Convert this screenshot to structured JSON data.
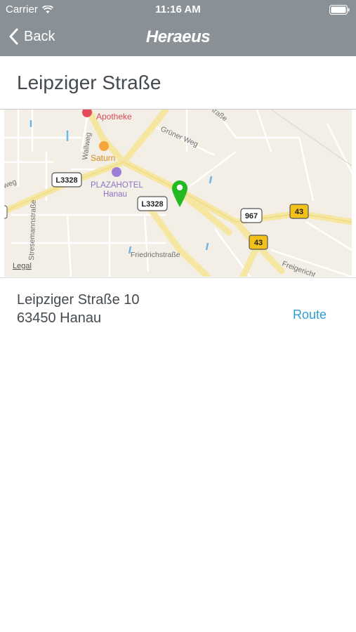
{
  "status_bar": {
    "carrier": "Carrier",
    "time": "11:16 AM"
  },
  "nav_bar": {
    "back_label": "Back",
    "logo_text": "Heraeus"
  },
  "page_title": "Leipziger Straße",
  "map": {
    "pois": {
      "pharmacy": "Apotheke",
      "saturn": "Saturn",
      "hotel_line1": "PLAZAHOTEL",
      "hotel_line2": "Hanau"
    },
    "streets": {
      "gruener_weg": "Grüner Weg",
      "wallweg": "Wallweg",
      "stresemannstrasse": "Stresemannstraße",
      "friedrichstrasse": "Friedrichstraße",
      "weg": "weg",
      "strasse_top": "traße",
      "freigericht": "Freigericht"
    },
    "road_badges": {
      "l3328_a": "L3328",
      "l3328_b": "L3328",
      "r967": "967",
      "r43_a": "43",
      "r43_b": "43"
    },
    "legal": "Legal",
    "pin_color": "#22b922"
  },
  "address": {
    "street": "Leipziger Straße 10",
    "city": "63450 Hanau",
    "route_label": "Route"
  },
  "colors": {
    "bar": "#8a9196",
    "accent": "#2f9dd6"
  }
}
